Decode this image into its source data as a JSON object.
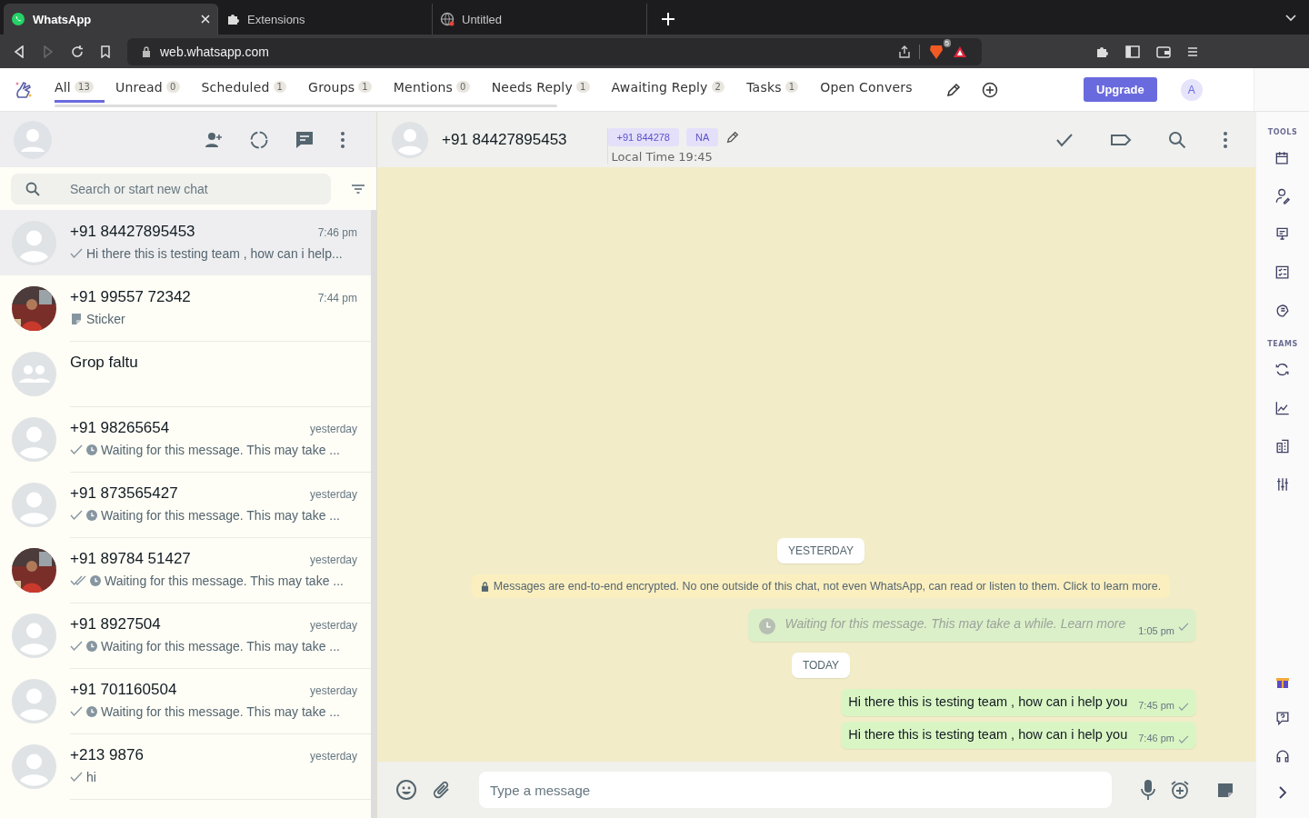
{
  "browser": {
    "tabs": [
      {
        "title": "WhatsApp",
        "selected": true,
        "kind": "whatsapp"
      },
      {
        "title": "Extensions",
        "selected": false,
        "kind": "puzzle"
      },
      {
        "title": "Untitled",
        "selected": false,
        "kind": "globe"
      }
    ],
    "url": "web.whatsapp.com",
    "shield_badge": "5"
  },
  "filters": [
    {
      "label": "All",
      "count": "13",
      "selected": true
    },
    {
      "label": "Unread",
      "count": "0",
      "selected": false
    },
    {
      "label": "Scheduled",
      "count": "1",
      "selected": false
    },
    {
      "label": "Groups",
      "count": "1",
      "selected": false
    },
    {
      "label": "Mentions",
      "count": "0",
      "selected": false
    },
    {
      "label": "Needs Reply",
      "count": "1",
      "selected": false
    },
    {
      "label": "Awaiting Reply",
      "count": "2",
      "selected": false
    },
    {
      "label": "Tasks",
      "count": "1",
      "selected": false
    },
    {
      "label": "Open Convers",
      "selected": false
    }
  ],
  "upgrade_button": "Upgrade",
  "account_initial": "A",
  "search": {
    "placeholder": "Search or start new chat"
  },
  "chats": [
    {
      "kind": "contact",
      "name": "+91 84427895453",
      "time": "7:46 pm",
      "sent": true,
      "preview": {
        "kind": "text",
        "text": "Hi there this is testing team , how can i help..."
      },
      "selected": true
    },
    {
      "name": "+91 99557 72342",
      "time": "7:44 pm",
      "preview": {
        "kind": "sticker",
        "text": "Sticker"
      },
      "selected": false
    },
    {
      "kind": "group",
      "name": "Grop faltu",
      "selected": false
    },
    {
      "kind": "contact",
      "name": "+91 98265654",
      "time": "yesterday",
      "sent": true,
      "preview": {
        "kind": "waiting",
        "text": "Waiting for this message. This may take ..."
      },
      "selected": false
    },
    {
      "kind": "contact",
      "name": "+91 873565427",
      "time": "yesterday",
      "sent": true,
      "preview": {
        "kind": "waiting",
        "text": "Waiting for this message. This may take ..."
      },
      "selected": false
    },
    {
      "name": "+91 89784 51427",
      "time": "yesterday",
      "sent": true,
      "delivered": true,
      "preview": {
        "kind": "waiting",
        "text": "Waiting for this message. This may take ..."
      },
      "selected": false
    },
    {
      "kind": "contact",
      "name": "+91 8927504",
      "time": "yesterday",
      "sent": true,
      "preview": {
        "kind": "waiting",
        "text": "Waiting for this message. This may take ..."
      },
      "selected": false
    },
    {
      "kind": "contact",
      "name": "+91 701160504",
      "time": "yesterday",
      "sent": true,
      "preview": {
        "kind": "waiting",
        "text": "Waiting for this message. This may take ..."
      },
      "selected": false
    },
    {
      "kind": "contact",
      "name": "+213 9876",
      "time": "yesterday",
      "sent": true,
      "preview": {
        "kind": "text",
        "text": "hi"
      },
      "selected": false
    }
  ],
  "conversation": {
    "name": "+91 84427895453",
    "tags": [
      "+91 844278",
      "NA"
    ],
    "local_time": "Local Time 19:45",
    "messages": [
      {
        "kind": "date",
        "text": "YESTERDAY"
      },
      {
        "kind": "notice",
        "text": "Messages are end-to-end encrypted. No one outside of this chat, not even WhatsApp, can read or listen to them. Click to learn more."
      },
      {
        "kind": "waiting",
        "text": "Waiting for this message. This may take a while. Learn more",
        "time": "1:05 pm"
      },
      {
        "kind": "date",
        "text": "TODAY"
      },
      {
        "kind": "text",
        "text": "Hi there this is testing team , how can i help you",
        "time": "7:45 pm"
      },
      {
        "kind": "text",
        "text": "Hi there this is testing team , how can i help you",
        "time": "7:46 pm"
      }
    ],
    "composer": {
      "placeholder": "Type a message"
    }
  },
  "side_toolbar": {
    "sections": [
      {
        "title": "TOOLS"
      },
      {
        "title": "TEAMS"
      }
    ]
  }
}
